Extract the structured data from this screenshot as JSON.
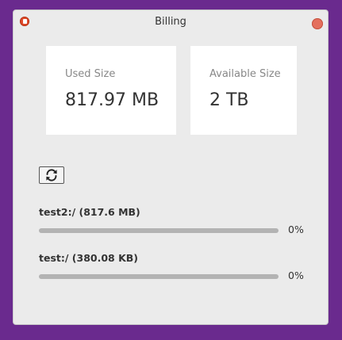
{
  "window": {
    "title": "Billing"
  },
  "cards": {
    "used": {
      "label": "Used Size",
      "value": "817.97 MB"
    },
    "available": {
      "label": "Available Size",
      "value": "2 TB"
    }
  },
  "toolbar": {
    "refresh_icon": "refresh-icon"
  },
  "storage": [
    {
      "name": "test2:/ (817.6 MB)",
      "percent_label": "0%",
      "progress": 0
    },
    {
      "name": "test:/ (380.08 KB)",
      "percent_label": "0%",
      "progress": 0
    }
  ],
  "colors": {
    "desktop_bg": "#6a2a8e",
    "window_bg": "#ebebeb",
    "close_button": "#e46f5d"
  }
}
